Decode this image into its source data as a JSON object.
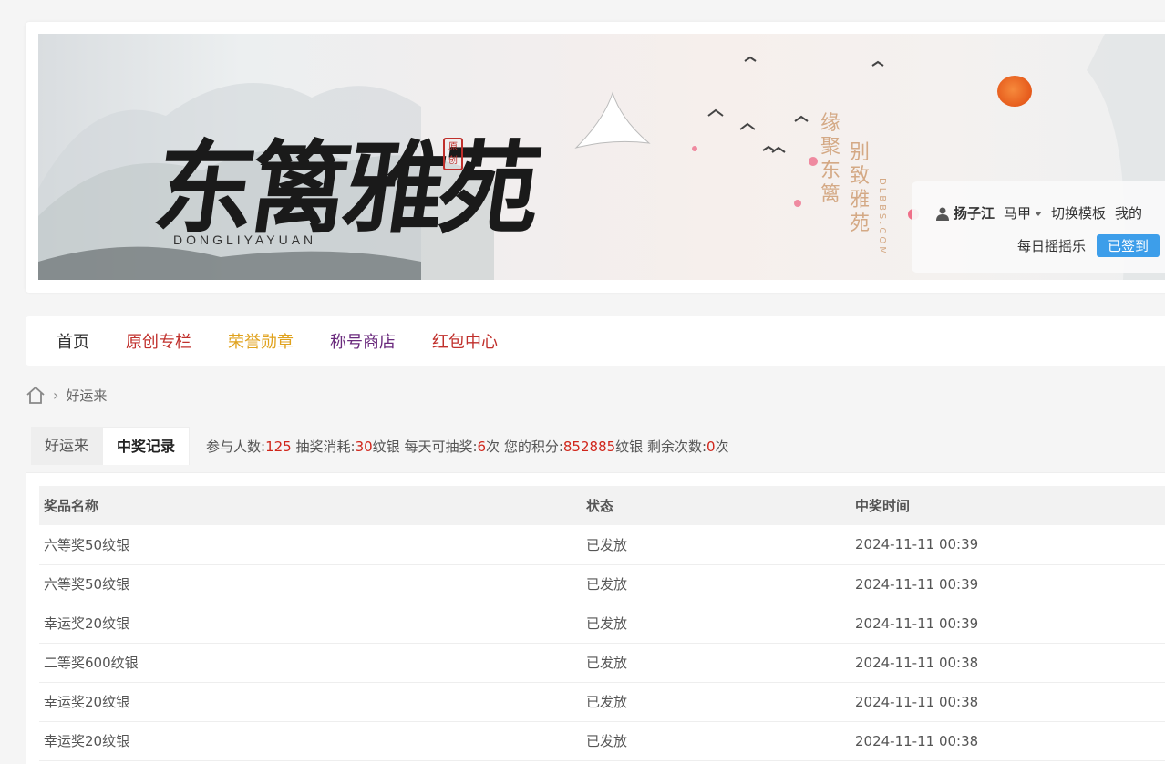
{
  "header": {
    "logo_text": "东篱雅苑",
    "logo_sub": "DONGLIYAYUAN",
    "seal_text": "原创",
    "poem_right": "缘聚东篱",
    "poem_left": "别致雅苑",
    "domain_vertical": "DLBBS.COM"
  },
  "user": {
    "name": "扬子江",
    "alt_account": "马甲",
    "switch_template": "切换模板",
    "my": "我的",
    "daily_game": "每日摇摇乐",
    "signed": "已签到"
  },
  "nav": {
    "items": [
      {
        "label": "首页",
        "color": "#333333"
      },
      {
        "label": "原创专栏",
        "color": "#c0302c"
      },
      {
        "label": "荣誉勋章",
        "color": "#e0a21d"
      },
      {
        "label": "称号商店",
        "color": "#6a2a7d"
      },
      {
        "label": "红包中心",
        "color": "#c0302c"
      }
    ]
  },
  "breadcrumb": {
    "home_icon": "home-icon",
    "current": "好运来"
  },
  "tabs": [
    {
      "label": "好运来",
      "active": false
    },
    {
      "label": "中奖记录",
      "active": true
    }
  ],
  "stats": {
    "participants_label": "参与人数:",
    "participants": "125",
    "cost_label": " 抽奖消耗:",
    "cost": "30",
    "cost_unit": "纹银",
    "daily_label": " 每天可抽奖:",
    "daily": "6",
    "daily_unit": "次",
    "points_label": " 您的积分:",
    "points": "852885",
    "points_unit": "纹银",
    "remaining_label": " 剩余次数:",
    "remaining": "0",
    "remaining_unit": "次"
  },
  "table": {
    "headers": [
      "奖品名称",
      "状态",
      "中奖时间"
    ],
    "rows": [
      [
        "六等奖50纹银",
        "已发放",
        "2024-11-11 00:39"
      ],
      [
        "六等奖50纹银",
        "已发放",
        "2024-11-11 00:39"
      ],
      [
        "幸运奖20纹银",
        "已发放",
        "2024-11-11 00:39"
      ],
      [
        "二等奖600纹银",
        "已发放",
        "2024-11-11 00:38"
      ],
      [
        "幸运奖20纹银",
        "已发放",
        "2024-11-11 00:38"
      ],
      [
        "幸运奖20纹银",
        "已发放",
        "2024-11-11 00:38"
      ]
    ]
  }
}
